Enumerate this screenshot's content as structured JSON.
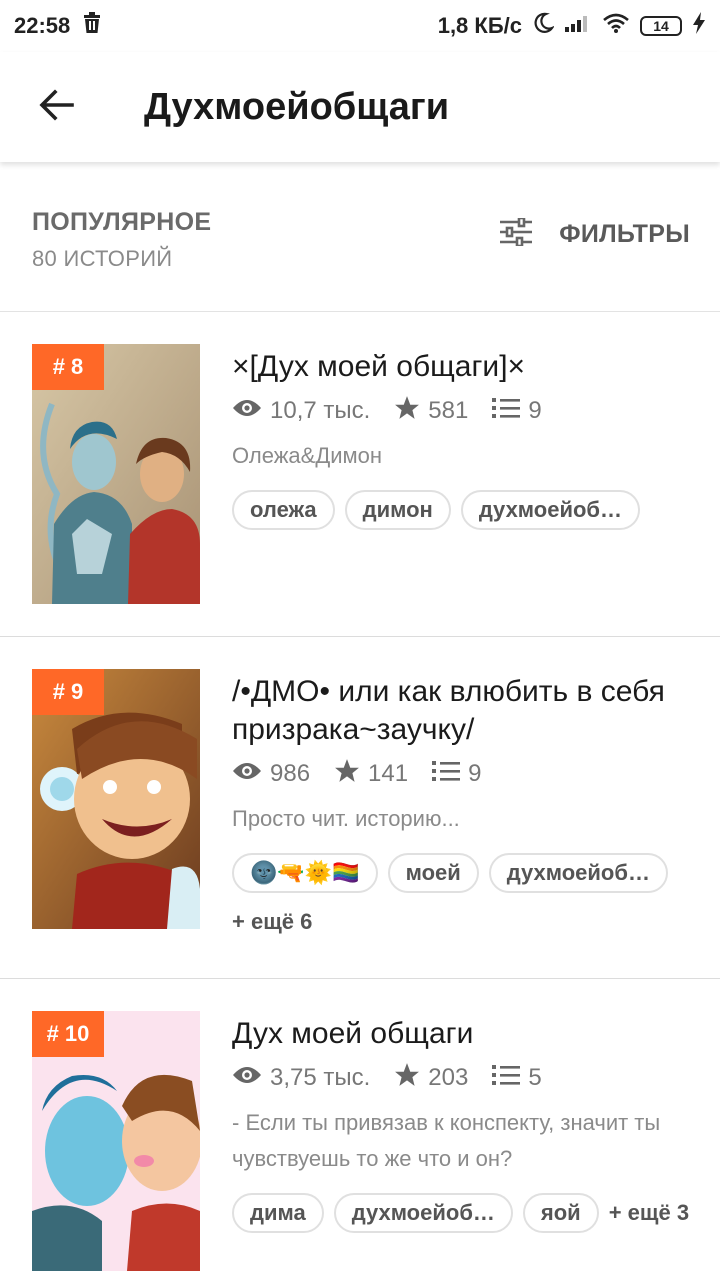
{
  "status_bar": {
    "time": "22:58",
    "network_speed": "1,8 КБ/с",
    "battery": "14",
    "icons": [
      "trash-icon",
      "moon-icon",
      "signal-icon",
      "wifi-icon",
      "battery-icon",
      "charging-icon"
    ]
  },
  "toolbar": {
    "title": "Духмоейобщаги",
    "back_icon": "arrow-left-icon"
  },
  "sort": {
    "title": "ПОПУЛЯРНОЕ",
    "count": "80 ИСТОРИЙ",
    "filters_label": "ФИЛЬТРЫ",
    "filters_icon": "sliders-icon"
  },
  "colors": {
    "accent": "#ff6827",
    "tag_border": "#e0e0e0",
    "text_primary": "#1b1b1b",
    "text_secondary": "#777777"
  },
  "stories": [
    {
      "rank": "# 8",
      "title": "×[Дух моей общаги]×",
      "views": "10,7 тыс.",
      "votes": "581",
      "parts": "9",
      "description": "Олежа&Димон",
      "tags": [
        "олежа",
        "димон",
        "духмоейоб…"
      ],
      "more": ""
    },
    {
      "rank": "# 9",
      "title": "/•ДМО• или как влюбить в себя призрака~заучку/",
      "views": "986",
      "votes": "141",
      "parts": "9",
      "description": "Просто чит. историю...",
      "tags": [
        "🌚🔫🌞🏳️‍🌈",
        "моей",
        "духмоейоб…"
      ],
      "more": "+ ещё 6"
    },
    {
      "rank": "# 10",
      "title": "Дух моей общаги",
      "views": "3,75 тыс.",
      "votes": "203",
      "parts": "5",
      "description": "- Если ты привязав к конспекту, значит ты чувствуешь то же что и он?",
      "tags": [
        "дима",
        "духмоейоб…",
        "яой"
      ],
      "more": "+ ещё 3"
    }
  ]
}
